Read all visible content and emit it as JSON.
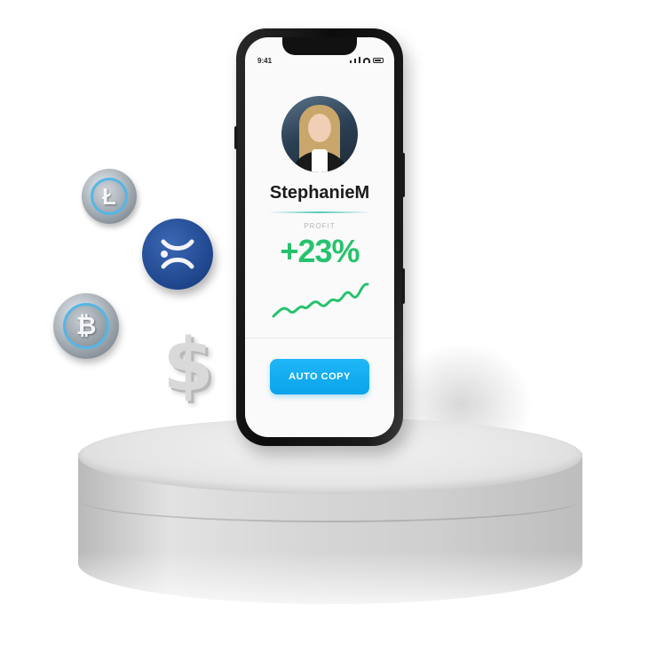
{
  "phone": {
    "status_time": "9:41",
    "username": "StephanieM",
    "profit_label": "PROFIT",
    "profit_value": "+23%",
    "action_button": "AUTO COPY"
  },
  "coins": {
    "litecoin_symbol": "Ł",
    "bitcoin_symbol": "₿",
    "dollar_symbol": "$"
  },
  "colors": {
    "profit_green": "#27c26d",
    "button_blue": "#0aa3ea",
    "ripple_blue": "#224a92",
    "coin_ring": "#54b6e6"
  }
}
